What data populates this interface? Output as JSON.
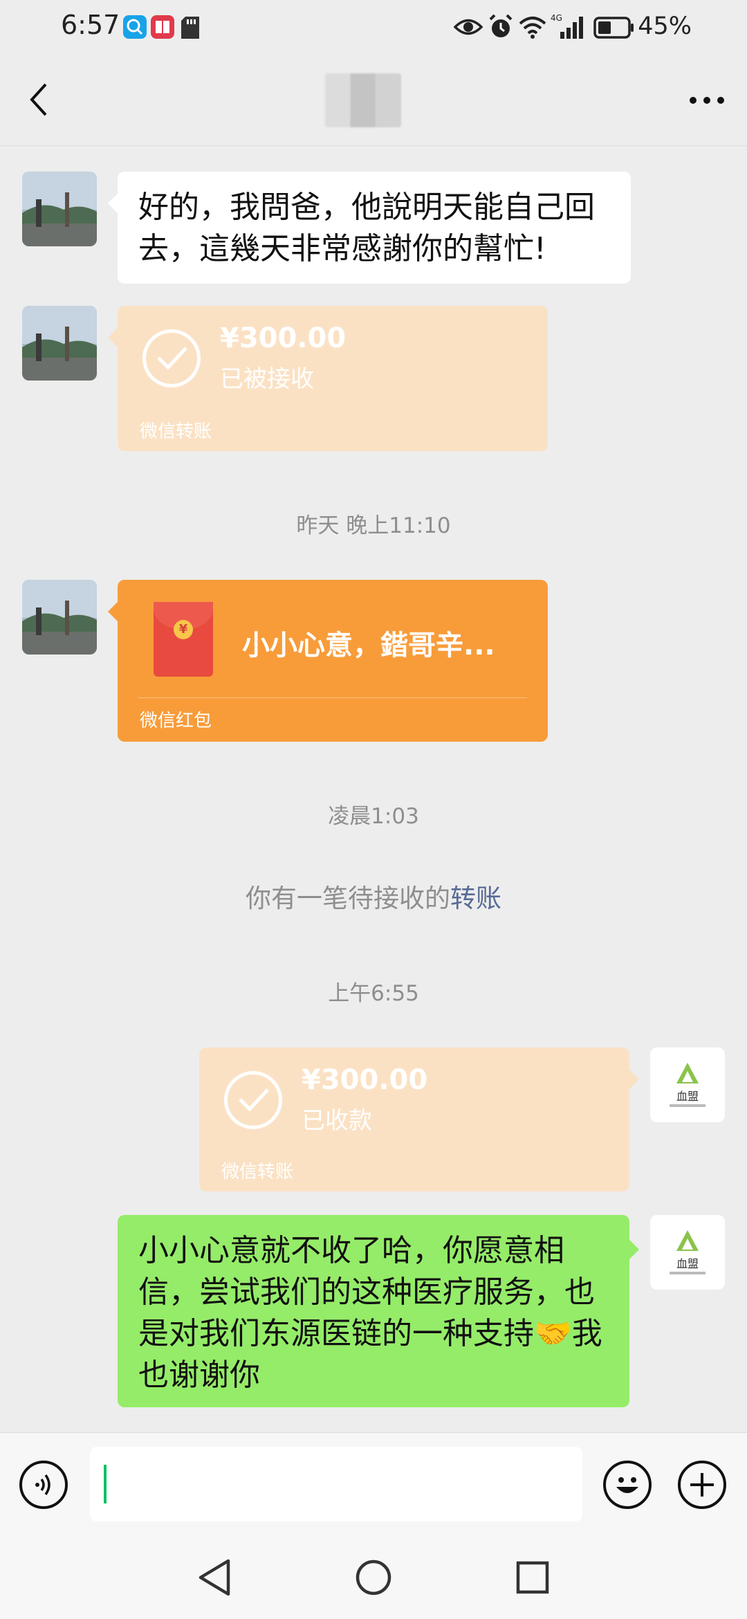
{
  "status_bar": {
    "time": "6:57",
    "battery_percent": "45%",
    "network": "4G",
    "battery_level": 0.45
  },
  "header": {
    "contact_name": "",
    "back_icon": "chevron-left-icon",
    "more_icon": "more-icon"
  },
  "messages": {
    "m1": {
      "text": "好的，我問爸，他說明天能自己回去，這幾天非常感謝你的幫忙!"
    },
    "m2": {
      "amount": "¥300.00",
      "status": "已被接收",
      "footer": "微信转账"
    },
    "ts1": "昨天 晚上11:10",
    "m3": {
      "title": "小小心意，鍇哥辛...",
      "footer": "微信红包"
    },
    "ts2": "凌晨1:03",
    "sys1": {
      "prefix": "你有一笔待接收的",
      "link": "转账"
    },
    "ts3": "上午6:55",
    "m4": {
      "amount": "¥300.00",
      "status": "已收款",
      "footer": "微信转账"
    },
    "m5": {
      "text": "小小心意就不收了哈，你愿意相信，尝试我们的这种医疗服务，也是对我们东源医链的一种支持🤝我也谢谢你"
    }
  },
  "self_avatar": {
    "logo_text": "血盟"
  },
  "input_bar": {
    "voice_icon": "voice-icon",
    "emoji_icon": "emoji-icon",
    "plus_icon": "plus-icon",
    "value": ""
  },
  "colors": {
    "background": "#ededed",
    "white_bubble": "#ffffff",
    "green_bubble": "#95ec69",
    "transfer_card": "#fbe1c4",
    "red_packet": "#f89c3a",
    "link": "#576b95",
    "timestamp": "#8e8e8e"
  }
}
